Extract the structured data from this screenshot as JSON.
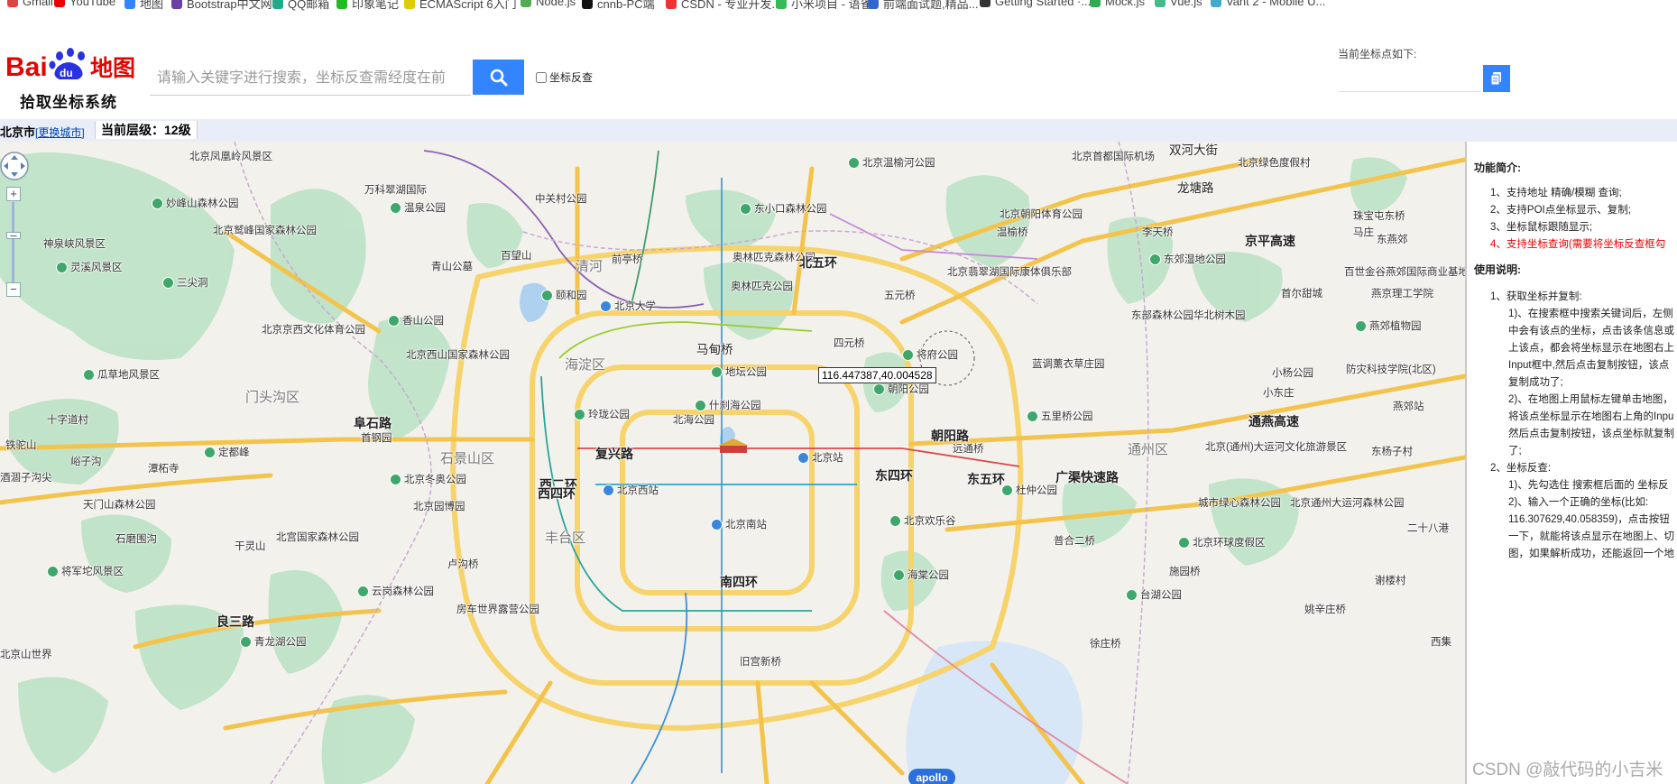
{
  "bookmarks": [
    "Gmail",
    "YouTube",
    "地图",
    "Bootstrap中文网",
    "QQ邮箱",
    "印象笔记",
    "ECMAScript 6入门",
    "Node.js",
    "cnnb-PC端",
    "CSDN - 专业开发...",
    "小米项目 - 语雀",
    "前端面试题,精品...",
    "Getting Started ·...",
    "Mock.js",
    "Vue.js",
    "Vant 2 - Mobile U..."
  ],
  "header": {
    "logo_text": "Baidu地图",
    "logo_sub": "拾取坐标系统",
    "search_placeholder": "请输入关键字进行搜索，坐标反查需经度在前",
    "search_icon": "search-icon",
    "reverse_label": "坐标反查",
    "coord_title": "当前坐标点如下:",
    "coord_value": "",
    "copy_icon": "copy-icon"
  },
  "infobar": {
    "city": "北京市",
    "change_city": "[更换城市]",
    "zoom_label": "当前层级：12级"
  },
  "map": {
    "coordinate_tip": "116.447387,40.004528",
    "apollo": "apollo",
    "labels": [
      {
        "t": "北京凤凰岭风景区",
        "c": "poi"
      },
      {
        "t": "妙峰山森林公园",
        "c": "poi"
      },
      {
        "t": "北京鹫峰国家森林公园",
        "c": "poi"
      },
      {
        "t": "神泉峡风景区",
        "c": "poi"
      },
      {
        "t": "灵溪风景区",
        "c": "poi"
      },
      {
        "t": "三尖洞",
        "c": "poi"
      },
      {
        "t": "万科翠湖国际",
        "c": "poi"
      },
      {
        "t": "温泉公园",
        "c": "poi"
      },
      {
        "t": "中关村公园",
        "c": "poi"
      },
      {
        "t": "东小口森林公园",
        "c": "poi"
      },
      {
        "t": "北京温榆河公园",
        "c": "poi"
      },
      {
        "t": "北京首都国际机场",
        "c": "poi"
      },
      {
        "t": "北京朝阳体育公园",
        "c": "poi"
      },
      {
        "t": "双河大街",
        "c": "road"
      },
      {
        "t": "北京绿色度假村",
        "c": "poi"
      },
      {
        "t": "龙塘路",
        "c": "road"
      },
      {
        "t": "珠宝屯东桥",
        "c": "poi"
      },
      {
        "t": "青山公墓",
        "c": "poi"
      },
      {
        "t": "百望山",
        "c": "poi"
      },
      {
        "t": "清河",
        "c": "dist"
      },
      {
        "t": "前亭桥",
        "c": "poi"
      },
      {
        "t": "奥林匹克森林公园",
        "c": "poi"
      },
      {
        "t": "北五环",
        "c": "road"
      },
      {
        "t": "温榆桥",
        "c": "poi"
      },
      {
        "t": "李天桥",
        "c": "poi"
      },
      {
        "t": "京平高速",
        "c": "road"
      },
      {
        "t": "东郊湿地公园",
        "c": "poi"
      },
      {
        "t": "百世金谷燕郊国际商业基地",
        "c": "poi"
      },
      {
        "t": "颐和园",
        "c": "poi"
      },
      {
        "t": "北京大学",
        "c": "poi"
      },
      {
        "t": "奥林匹克公园",
        "c": "poi"
      },
      {
        "t": "五元桥",
        "c": "poi"
      },
      {
        "t": "北京翡翠湖国际康体俱乐部",
        "c": "poi"
      },
      {
        "t": "首尔甜城",
        "c": "poi"
      },
      {
        "t": "燕京理工学院",
        "c": "poi"
      },
      {
        "t": "香山公园",
        "c": "poi"
      },
      {
        "t": "北京京西文化体育公园",
        "c": "poi"
      },
      {
        "t": "东部森林公园华北树木园",
        "c": "poi"
      },
      {
        "t": "燕郊植物园",
        "c": "poi"
      },
      {
        "t": "马甸桥",
        "c": "poi"
      },
      {
        "t": "四元桥",
        "c": "poi"
      },
      {
        "t": "将府公园",
        "c": "poi"
      },
      {
        "t": "北京西山国家森林公园",
        "c": "poi"
      },
      {
        "t": "海淀区",
        "c": "dist"
      },
      {
        "t": "地坛公园",
        "c": "poi"
      },
      {
        "t": "瓜草地风景区",
        "c": "poi"
      },
      {
        "t": "门头沟区",
        "c": "dist"
      },
      {
        "t": "朝阳公园",
        "c": "poi"
      },
      {
        "t": "蓝调薰衣草庄园",
        "c": "poi"
      },
      {
        "t": "小杨公园",
        "c": "poi"
      },
      {
        "t": "防灾科技学院(北区)",
        "c": "poi"
      },
      {
        "t": "什刹海公园",
        "c": "poi"
      },
      {
        "t": "北海公园",
        "c": "poi"
      },
      {
        "t": "玲珑公园",
        "c": "poi"
      },
      {
        "t": "五里桥公园",
        "c": "poi"
      },
      {
        "t": "燕郊站",
        "c": "poi"
      },
      {
        "t": "阜石路",
        "c": "road"
      },
      {
        "t": "首钢园",
        "c": "poi"
      },
      {
        "t": "朝阳路",
        "c": "road"
      },
      {
        "t": "远通桥",
        "c": "poi"
      },
      {
        "t": "通燕高速",
        "c": "road"
      },
      {
        "t": "十字道村",
        "c": "poi"
      },
      {
        "t": "铁驼山",
        "c": "poi"
      },
      {
        "t": "峪子沟",
        "c": "poi"
      },
      {
        "t": "定都峰",
        "c": "poi"
      },
      {
        "t": "复兴路",
        "c": "road"
      },
      {
        "t": "西二环",
        "c": "road"
      },
      {
        "t": "北京站",
        "c": "poi"
      },
      {
        "t": "通州区",
        "c": "dist"
      },
      {
        "t": "北京(通州)大运河文化旅游景区",
        "c": "poi"
      },
      {
        "t": "石景山区",
        "c": "dist"
      },
      {
        "t": "潭柘寺",
        "c": "poi"
      },
      {
        "t": "酒涸子沟尖",
        "c": "poi"
      },
      {
        "t": "北京冬奥公园",
        "c": "poi"
      },
      {
        "t": "北京西站",
        "c": "poi"
      },
      {
        "t": "东四环",
        "c": "road"
      },
      {
        "t": "东五环",
        "c": "road"
      },
      {
        "t": "杜仲公园",
        "c": "poi"
      },
      {
        "t": "广渠快速路",
        "c": "road"
      },
      {
        "t": "天门山森林公园",
        "c": "poi"
      },
      {
        "t": "北京园博园",
        "c": "poi"
      },
      {
        "t": "西四环",
        "c": "road"
      },
      {
        "t": "北京南站",
        "c": "poi"
      },
      {
        "t": "北京欢乐谷",
        "c": "poi"
      },
      {
        "t": "城市绿心森林公园",
        "c": "poi"
      },
      {
        "t": "北京通州大运河森林公园",
        "c": "poi"
      },
      {
        "t": "石磨围沟",
        "c": "poi"
      },
      {
        "t": "北宫国家森林公园",
        "c": "poi"
      },
      {
        "t": "丰台区",
        "c": "dist"
      },
      {
        "t": "普合二桥",
        "c": "poi"
      },
      {
        "t": "北京环球度假区",
        "c": "poi"
      },
      {
        "t": "将军坨风景区",
        "c": "poi"
      },
      {
        "t": "干灵山",
        "c": "poi"
      },
      {
        "t": "卢沟桥",
        "c": "poi"
      },
      {
        "t": "南四环",
        "c": "road"
      },
      {
        "t": "海棠公园",
        "c": "poi"
      },
      {
        "t": "施园桥",
        "c": "poi"
      },
      {
        "t": "云岗森林公园",
        "c": "poi"
      },
      {
        "t": "房车世界露营公园",
        "c": "poi"
      },
      {
        "t": "台湖公园",
        "c": "poi"
      },
      {
        "t": "姚辛庄桥",
        "c": "poi"
      },
      {
        "t": "良三路",
        "c": "road"
      },
      {
        "t": "北京山世界",
        "c": "poi"
      },
      {
        "t": "青龙湖公园",
        "c": "poi"
      },
      {
        "t": "旧宫新桥",
        "c": "poi"
      },
      {
        "t": "徐庄桥",
        "c": "poi"
      },
      {
        "t": "西集",
        "c": "poi"
      },
      {
        "t": "小东庄",
        "c": "poi"
      },
      {
        "t": "马庄",
        "c": "poi"
      },
      {
        "t": "东燕郊",
        "c": "poi"
      },
      {
        "t": "二十八港",
        "c": "poi"
      },
      {
        "t": "东杨子村",
        "c": "poi"
      },
      {
        "t": "谢楼村",
        "c": "poi"
      }
    ]
  },
  "panel": {
    "feature_title": "功能简介:",
    "features": [
      "1、支持地址 精确/模糊 查询;",
      "2、支持POI点坐标显示、复制;",
      "3、坐标鼠标跟随显示;",
      "4、支持坐标查询(需要将坐标反查框勾"
    ],
    "usage_title": "使用说明:",
    "usage": [
      "1、获取坐标并复制:",
      "1)、在搜索框中搜索关键词后，左侧",
      "中会有该点的坐标，点击该条信息或",
      "上该点，都会将坐标显示在地图右上",
      "Input框中,然后点击复制按钮，该点",
      "复制成功了;",
      "2)、在地图上用鼠标左键单击地图，",
      "将该点坐标显示在地图右上角的Inpu",
      "然后点击复制按钮，该点坐标就复制",
      "了;",
      "2、坐标反查:",
      "1)、先勾选住 搜索框后面的 坐标反",
      "2)、输入一个正确的坐标(比如:",
      "116.307629,40.058359)，点击按钮",
      "一下，就能将该点显示在地图上、切",
      "图，如果解析成功，还能返回一个地"
    ]
  },
  "watermark": "CSDN @敲代码的小吉米"
}
